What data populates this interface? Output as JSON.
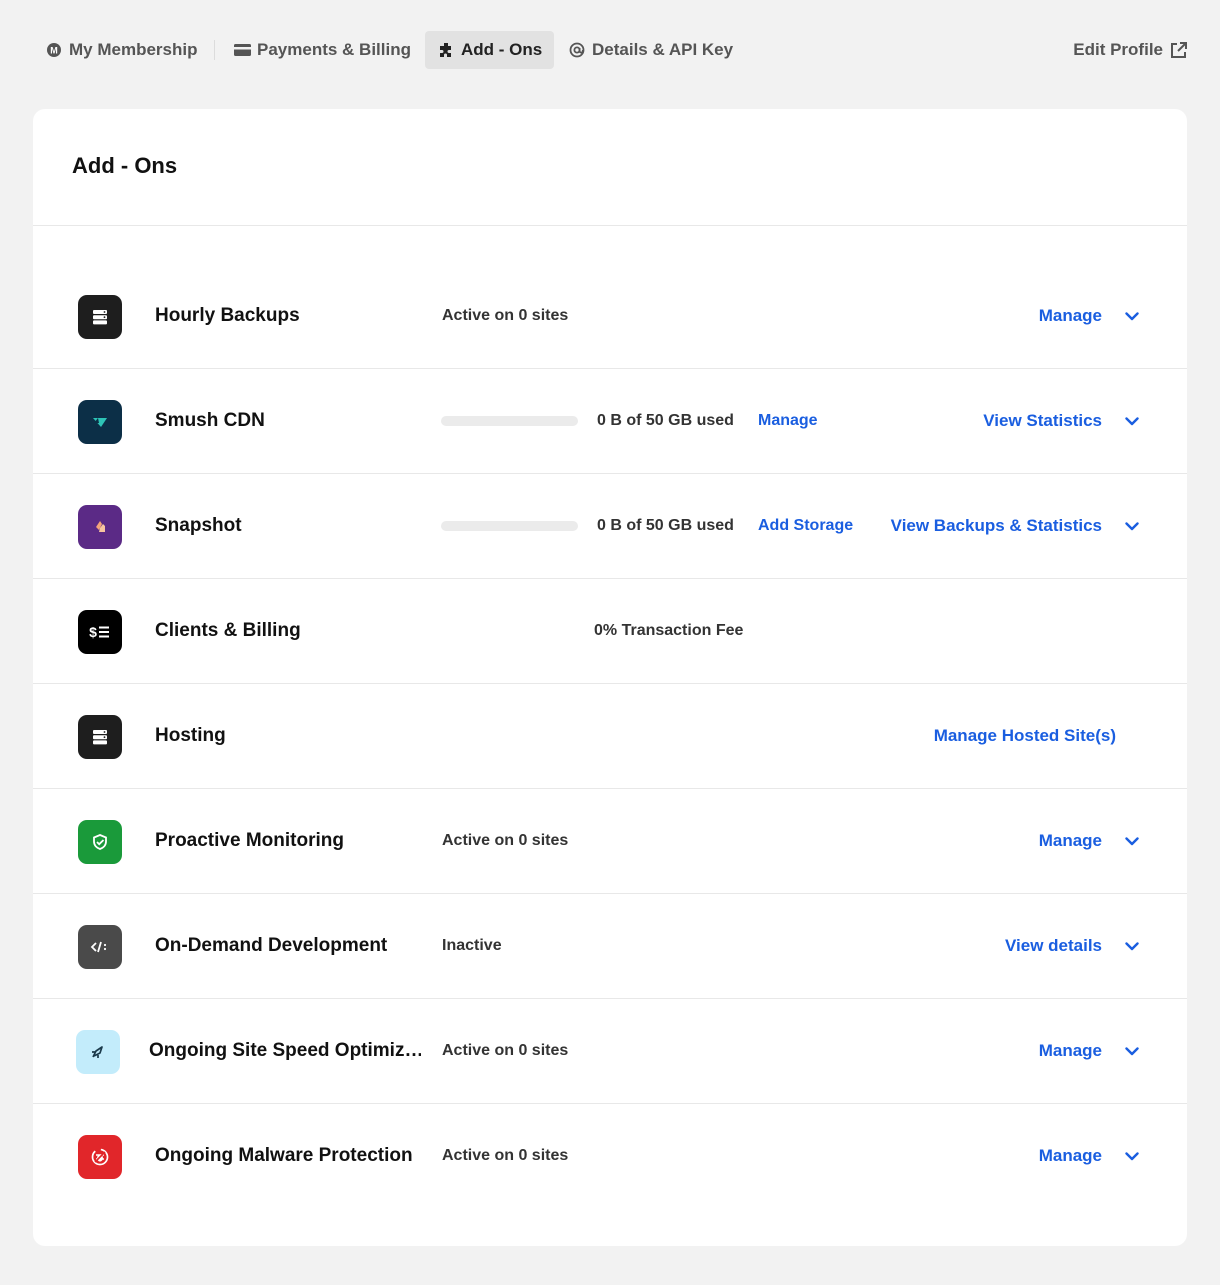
{
  "nav": {
    "tabs": [
      {
        "label": "My Membership",
        "icon": "membership-icon"
      },
      {
        "label": "Payments & Billing",
        "icon": "card-icon"
      },
      {
        "label": "Add - Ons",
        "icon": "puzzle-icon",
        "active": true
      },
      {
        "label": "Details & API Key",
        "icon": "at-icon"
      }
    ],
    "edit_profile": "Edit Profile"
  },
  "page": {
    "title": "Add - Ons"
  },
  "addons": [
    {
      "name": "Hourly Backups",
      "status": "Active on 0 sites",
      "action": "Manage",
      "icon": "server-icon",
      "color": "#1e1e1e"
    },
    {
      "name": "Smush CDN",
      "usage": "0 B of 50 GB used",
      "progress": 0,
      "mid_link": "Manage",
      "action": "View Statistics",
      "icon": "smush-icon",
      "color": "#0c2f47"
    },
    {
      "name": "Snapshot",
      "usage": "0 B of 50 GB used",
      "progress": 0,
      "mid_link": "Add Storage",
      "action": "View Backups & Statistics",
      "icon": "snapshot-icon",
      "color": "#5b2a86"
    },
    {
      "name": "Clients & Billing",
      "fee": "0% Transaction Fee",
      "icon": "dollar-list-icon",
      "color": "#000000"
    },
    {
      "name": "Hosting",
      "action": "Manage Hosted Site(s)",
      "icon": "server-icon",
      "color": "#1e1e1e"
    },
    {
      "name": "Proactive Monitoring",
      "status": "Active on 0 sites",
      "action": "Manage",
      "icon": "shield-check-icon",
      "color": "#1a9a3a"
    },
    {
      "name": "On-Demand Development",
      "status": "Inactive",
      "action": "View details",
      "icon": "code-icon",
      "color": "#4a4a4a"
    },
    {
      "name": "Ongoing Site Speed Optimiz…",
      "status": "Active on 0 sites",
      "action": "Manage",
      "icon": "rocket-icon",
      "color": "#c3ecfb"
    },
    {
      "name": "Ongoing Malware Protection",
      "status": "Active on 0 sites",
      "action": "Manage",
      "icon": "bug-shield-icon",
      "color": "#e1262a"
    }
  ],
  "colors": {
    "link": "#1a5ee0",
    "background": "#f2f2f2"
  }
}
